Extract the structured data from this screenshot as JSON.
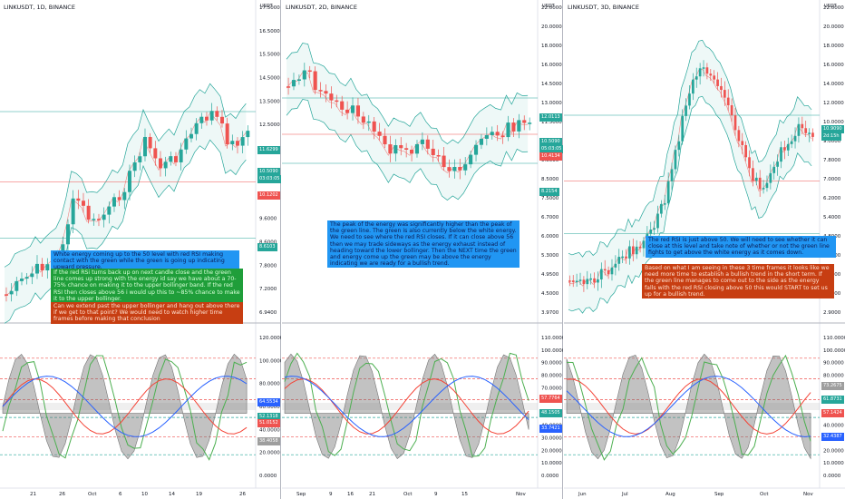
{
  "panels": [
    {
      "title": "LINKUSDT, 1D, BINANCE",
      "price_ticks": [
        "17.5000",
        "16.5000",
        "15.5000",
        "14.5000",
        "13.5000",
        "12.5000",
        "11.5000",
        "11.4000",
        "10.4000",
        "9.6000",
        "8.6000",
        "7.8000",
        "7.2000",
        "6.9400"
      ],
      "usdt": "USDT",
      "tags": [
        {
          "text": "11.6299",
          "color": "#26a69a"
        },
        {
          "text": "10.5090",
          "color": "#26a69a"
        },
        {
          "text": "03:03:05",
          "color": "#26a69a"
        },
        {
          "text": "10.1202",
          "color": "#ef5350"
        },
        {
          "text": "8.6103",
          "color": "#26a69a"
        }
      ],
      "notes": [
        {
          "style": "blue",
          "text": "White energy coming up to the 50 level with red RSI making contact with the green while the green is going up indicating upward pressure."
        },
        {
          "style": "green",
          "text": "If the red RSi turns back up on next candle close and the green line comes up strong with the energy id say we have about a 70-75% chance on making it to the upper bollinger band. If the red RSI then closes above 56 i would up this to ~85% chance to make it to the upper bollinger."
        },
        {
          "style": "red",
          "text": "Can we extend past the upper bollinger and hang out above there if we get to that point? We would need to watch higher time frames before making that conclusion"
        }
      ],
      "osc_ticks": [
        "120.0000",
        "100.0000",
        "80.0000",
        "60.0000",
        "40.0000",
        "20.0000",
        "0.0000"
      ],
      "osc_tags": [
        {
          "text": "64.5534",
          "color": "#2962ff"
        },
        {
          "text": "52.1318",
          "color": "#26a69a"
        },
        {
          "text": "51.0152",
          "color": "#ef5350"
        },
        {
          "text": "38.4058",
          "color": "#9e9e9e"
        }
      ],
      "dates": [
        "21",
        "26",
        "Oct",
        "6",
        "10",
        "14",
        "19",
        "26"
      ]
    },
    {
      "title": "LINKUSDT, 2D, BINANCE",
      "price_ticks": [
        "22.0000",
        "20.0000",
        "18.0000",
        "16.0000",
        "14.5000",
        "13.0000",
        "11.5000",
        "10.5000",
        "9.5000",
        "8.5000",
        "7.5000",
        "6.7000",
        "6.0000",
        "5.3000",
        "4.9500",
        "4.5000",
        "3.9700"
      ],
      "usdt": "USDT",
      "tags": [
        {
          "text": "12.0113",
          "color": "#26a69a"
        },
        {
          "text": "10.5090",
          "color": "#26a69a"
        },
        {
          "text": "05:03:05",
          "color": "#26a69a"
        },
        {
          "text": "10.4134",
          "color": "#ef5350"
        },
        {
          "text": "8.2154",
          "color": "#26a69a"
        }
      ],
      "notes": [
        {
          "style": "blue",
          "text": "The peak of the energy was significantly higher than the peak of the green line. The green is also currently below the white energy. We need to see where the red RSI closes. If it can close above 56 then we may trade sideways as the energy exhaust instead of heading toward the lower bollinger. Then the NEXT time the green and energy come up the green may be above the energy indicating we are ready for a bullish trend."
        }
      ],
      "osc_ticks": [
        "110.0000",
        "100.0000",
        "90.0000",
        "80.0000",
        "70.0000",
        "60.0000",
        "50.0000",
        "40.0000",
        "30.0000",
        "20.0000",
        "10.0000",
        "0.0000"
      ],
      "osc_tags": [
        {
          "text": "57.7764",
          "color": "#ef5350"
        },
        {
          "text": "48.1505",
          "color": "#26a69a"
        },
        {
          "text": "33.7421",
          "color": "#2962ff"
        }
      ],
      "dates": [
        "Sep",
        "9",
        "16",
        "21",
        "Oct",
        "9",
        "15",
        "Nov"
      ]
    },
    {
      "title": "LINKUSDT, 3D, BINANCE",
      "price_ticks": [
        "22.0000",
        "20.0000",
        "18.0000",
        "16.0000",
        "14.0000",
        "12.0000",
        "10.0000",
        "9.0000",
        "7.8000",
        "7.0000",
        "6.2000",
        "5.4000",
        "4.8000",
        "4.2000",
        "3.7500",
        "3.3000",
        "2.9000"
      ],
      "usdt": "USDT",
      "tags": [
        {
          "text": "10.9090",
          "color": "#26a69a"
        },
        {
          "text": "2d:15h",
          "color": "#26a69a"
        }
      ],
      "notes": [
        {
          "style": "blue",
          "text": "The red RSI is just above 50. We will need to see whether it can close at this level and take note of whether or not the green line fights to get above the white energy as it comes down."
        },
        {
          "style": "red",
          "text": "Based on what I am seeing in these 3 time frames it looks like we need more time to establish a bullish trend in the short term. If the green line manages to come out to the side as the energy falls with the red RSI closing above 50 this would START to set us up for a bullish trend."
        }
      ],
      "osc_ticks": [
        "110.0000",
        "100.0000",
        "90.0000",
        "80.0000",
        "70.0000",
        "60.0000",
        "50.0000",
        "40.0000",
        "30.0000",
        "20.0000",
        "10.0000",
        "0.0000"
      ],
      "osc_tags": [
        {
          "text": "73.2675",
          "color": "#9e9e9e"
        },
        {
          "text": "61.8731",
          "color": "#26a69a"
        },
        {
          "text": "57.1424",
          "color": "#ef5350"
        },
        {
          "text": "32.4387",
          "color": "#2962ff"
        }
      ],
      "dates": [
        "Jun",
        "Jul",
        "Aug",
        "Sep",
        "Oct",
        "Nov"
      ]
    }
  ]
}
